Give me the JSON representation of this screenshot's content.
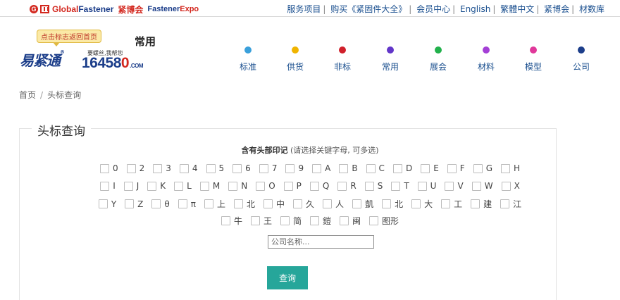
{
  "brand": {
    "globalfastener_global": "Global",
    "globalfastener_fastener": "Fastener",
    "expo_cn": "紧博会",
    "expo_en_a": "Fastener",
    "expo_en_b": "Expo"
  },
  "top_links": [
    "服务项目",
    "购买《紧固件大全》",
    "会员中心",
    "English",
    "繁體中文",
    "紧博会",
    "材数库"
  ],
  "logo": {
    "bubble": "点击标志返回首页",
    "name_cn": "易紧通",
    "slogan": "要螺丝,我帮您",
    "number_a": "16458",
    "number_b": "0",
    "number_com": ".COM"
  },
  "page_heading": "常用",
  "nav": [
    {
      "label": "标准",
      "color": "#3aa0db"
    },
    {
      "label": "供货",
      "color": "#f0b400"
    },
    {
      "label": "非标",
      "color": "#d0202b"
    },
    {
      "label": "常用",
      "color": "#6236c9"
    },
    {
      "label": "展会",
      "color": "#22b14c"
    },
    {
      "label": "材料",
      "color": "#a43fd6"
    },
    {
      "label": "模型",
      "color": "#e0389a"
    },
    {
      "label": "公司",
      "color": "#1c3e8a"
    }
  ],
  "breadcrumb": {
    "home": "首页",
    "separator": "/",
    "current": "头标查询"
  },
  "panel": {
    "legend": "头标查询",
    "subtitle_bold": "含有头部印记",
    "subtitle_hint": "(请选择关键字母, 可多选)"
  },
  "checkbox_rows": [
    [
      "0",
      "2",
      "3",
      "4",
      "5",
      "6",
      "7",
      "9",
      "A",
      "B",
      "C",
      "D",
      "E",
      "F",
      "G",
      "H"
    ],
    [
      "I",
      "J",
      "K",
      "L",
      "M",
      "N",
      "O",
      "P",
      "Q",
      "R",
      "S",
      "T",
      "U",
      "V",
      "W",
      "X"
    ],
    [
      "Y",
      "Z",
      "θ",
      "π",
      "上",
      "北",
      "中",
      "久",
      "人",
      "凱",
      "北",
      "大",
      "工",
      "建",
      "江"
    ],
    [
      "牛",
      "王",
      "简",
      "鎧",
      "闽",
      "图形"
    ]
  ],
  "company_input": {
    "placeholder": "公司名称...",
    "value": ""
  },
  "query_button": "查询"
}
